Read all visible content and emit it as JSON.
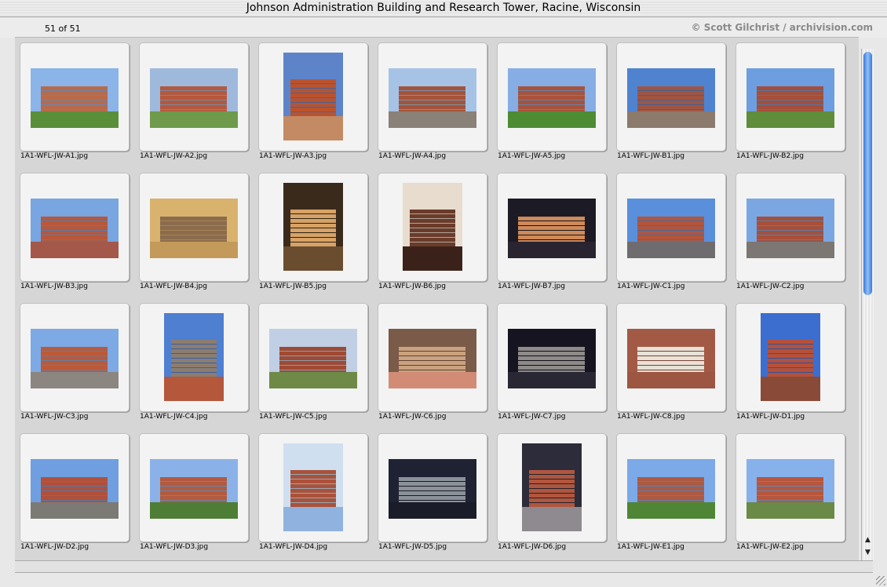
{
  "window": {
    "title": "Johnson Administration Building and Research Tower, Racine, Wisconsin",
    "count": "51 of 51",
    "credit": "© Scott Gilchrist / archivision.com"
  },
  "colors": {
    "brick": "#b8543a",
    "sky": "#6f98d6",
    "grass": "#4c8a35",
    "pavement": "#8d8a86",
    "scroll_accent": "#3a79d8"
  },
  "images": [
    {
      "label": "1A1-WFL-JW-A1.jpg",
      "orient": "land",
      "sky": "#8bb4e8",
      "main": "#b86a4a",
      "ground": "#5a8f3a"
    },
    {
      "label": "1A1-WFL-JW-A2.jpg",
      "orient": "land",
      "sky": "#9fb9dc",
      "main": "#b5583d",
      "ground": "#6f9a4c"
    },
    {
      "label": "1A1-WFL-JW-A3.jpg",
      "orient": "port",
      "sky": "#5d84c9",
      "main": "#b9532f",
      "ground": "#c48a63"
    },
    {
      "label": "1A1-WFL-JW-A4.jpg",
      "orient": "land",
      "sky": "#a6c3e6",
      "main": "#a4533b",
      "ground": "#8a8178"
    },
    {
      "label": "1A1-WFL-JW-A5.jpg",
      "orient": "land",
      "sky": "#86aee4",
      "main": "#a7533c",
      "ground": "#4e8c33"
    },
    {
      "label": "1A1-WFL-JW-B1.jpg",
      "orient": "land",
      "sky": "#4f83d0",
      "main": "#9f5543",
      "ground": "#8c7a6c"
    },
    {
      "label": "1A1-WFL-JW-B2.jpg",
      "orient": "land",
      "sky": "#6d9ee0",
      "main": "#a44f3a",
      "ground": "#5f8d3b"
    },
    {
      "label": "1A1-WFL-JW-B3.jpg",
      "orient": "land",
      "sky": "#79a5e0",
      "main": "#b5583d",
      "ground": "#a3584a"
    },
    {
      "label": "1A1-WFL-JW-B4.jpg",
      "orient": "land",
      "sky": "#d9b26e",
      "main": "#8b6b4c",
      "ground": "#c49a5a"
    },
    {
      "label": "1A1-WFL-JW-B5.jpg",
      "orient": "port",
      "sky": "#3a2a1c",
      "main": "#d7a266",
      "ground": "#6a4d2f"
    },
    {
      "label": "1A1-WFL-JW-B6.jpg",
      "orient": "port",
      "sky": "#e8dccf",
      "main": "#6b3b2a",
      "ground": "#3a221a"
    },
    {
      "label": "1A1-WFL-JW-B7.jpg",
      "orient": "land",
      "sky": "#1c1a24",
      "main": "#cf8a5a",
      "ground": "#2a2330"
    },
    {
      "label": "1A1-WFL-JW-C1.jpg",
      "orient": "land",
      "sky": "#5a8fdc",
      "main": "#b0563d",
      "ground": "#6f6c70"
    },
    {
      "label": "1A1-WFL-JW-C2.jpg",
      "orient": "land",
      "sky": "#7aa7e2",
      "main": "#a5503b",
      "ground": "#7c7773"
    },
    {
      "label": "1A1-WFL-JW-C3.jpg",
      "orient": "land",
      "sky": "#7da9e4",
      "main": "#b95a3b",
      "ground": "#8c8681"
    },
    {
      "label": "1A1-WFL-JW-C4.jpg",
      "orient": "port",
      "sky": "#4e7fd0",
      "main": "#8c7d70",
      "ground": "#b5573b"
    },
    {
      "label": "1A1-WFL-JW-C5.jpg",
      "orient": "land",
      "sky": "#c0cfe4",
      "main": "#9e4a35",
      "ground": "#6e8a46"
    },
    {
      "label": "1A1-WFL-JW-C6.jpg",
      "orient": "land",
      "sky": "#7a5a48",
      "main": "#cba27f",
      "ground": "#d28b74"
    },
    {
      "label": "1A1-WFL-JW-C7.jpg",
      "orient": "land",
      "sky": "#151420",
      "main": "#8e8a88",
      "ground": "#2a2735"
    },
    {
      "label": "1A1-WFL-JW-C8.jpg",
      "orient": "land",
      "sky": "#a35a45",
      "main": "#e9e1d6",
      "ground": "#9d5642"
    },
    {
      "label": "1A1-WFL-JW-D1.jpg",
      "orient": "port",
      "sky": "#3c6ed0",
      "main": "#b5513a",
      "ground": "#8a4a38"
    },
    {
      "label": "1A1-WFL-JW-D2.jpg",
      "orient": "land",
      "sky": "#6f9fe0",
      "main": "#b0503b",
      "ground": "#7c7a75"
    },
    {
      "label": "1A1-WFL-JW-D3.jpg",
      "orient": "land",
      "sky": "#8ab2e8",
      "main": "#b35a3f",
      "ground": "#4e7d35"
    },
    {
      "label": "1A1-WFL-JW-D4.jpg",
      "orient": "port",
      "sky": "#cfdff0",
      "main": "#a9523b",
      "ground": "#8fb3de"
    },
    {
      "label": "1A1-WFL-JW-D5.jpg",
      "orient": "land",
      "sky": "#1e2232",
      "main": "#8b9198",
      "ground": "#1a1d29"
    },
    {
      "label": "1A1-WFL-JW-D6.jpg",
      "orient": "port",
      "sky": "#2c2c3a",
      "main": "#b0563f",
      "ground": "#8f8a90"
    },
    {
      "label": "1A1-WFL-JW-E1.jpg",
      "orient": "land",
      "sky": "#7ca9e8",
      "main": "#ac5a42",
      "ground": "#4f8635"
    },
    {
      "label": "1A1-WFL-JW-E2.jpg",
      "orient": "land",
      "sky": "#87b1ea",
      "main": "#b7563d",
      "ground": "#6a8a48"
    }
  ],
  "icons": {
    "scroll_up": "triangle-up",
    "scroll_down": "triangle-down",
    "resize": "grow-box"
  }
}
